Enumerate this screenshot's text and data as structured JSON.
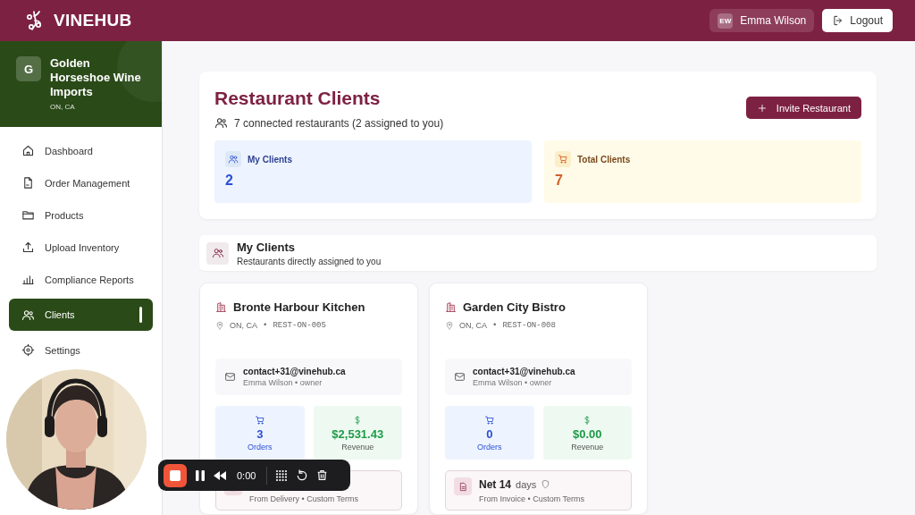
{
  "app": {
    "name": "VINEHUB"
  },
  "user": {
    "initials": "EW",
    "name": "Emma Wilson"
  },
  "logout": "Logout",
  "org": {
    "initial": "G",
    "name": "Golden Horseshoe Wine Imports",
    "region": "ON, CA"
  },
  "nav": [
    {
      "label": "Dashboard",
      "selected": false
    },
    {
      "label": "Order Management",
      "selected": false
    },
    {
      "label": "Products",
      "selected": false
    },
    {
      "label": "Upload Inventory",
      "selected": false
    },
    {
      "label": "Compliance Reports",
      "selected": false
    },
    {
      "label": "Clients",
      "selected": true
    },
    {
      "label": "Settings",
      "selected": false
    }
  ],
  "page": {
    "title": "Restaurant Clients",
    "subtitle": "7 connected restaurants (2 assigned to you)",
    "action": "Invite Restaurant"
  },
  "stats": [
    {
      "label": "My Clients",
      "value": "2",
      "kind": "people"
    },
    {
      "label": "Total Clients",
      "value": "7",
      "kind": "cart"
    }
  ],
  "section": {
    "title": "My Clients",
    "subtitle": "Restaurants directly assigned to you"
  },
  "clients": [
    {
      "name": "Bronte Harbour Kitchen",
      "region": "ON, CA",
      "separator": "•",
      "code": "REST-ON-005",
      "email": "contact+31@vinehub.ca",
      "contact": "Emma Wilson • owner",
      "orders": "3",
      "orders_label": "Orders",
      "revenue": "$2,531.43",
      "revenue_label": "Revenue",
      "terms_note": "From Delivery • Custom Terms"
    },
    {
      "name": "Garden City Bistro",
      "region": "ON, CA",
      "separator": "•",
      "code": "REST-ON-008",
      "email": "contact+31@vinehub.ca",
      "contact": "Emma Wilson • owner",
      "orders": "0",
      "orders_label": "Orders",
      "revenue": "$0.00",
      "revenue_label": "Revenue",
      "terms_title": "Net 14",
      "terms_unit": "days",
      "terms_note": "From Invoice • Custom Terms"
    }
  ],
  "recorder": {
    "time": "0:00"
  }
}
